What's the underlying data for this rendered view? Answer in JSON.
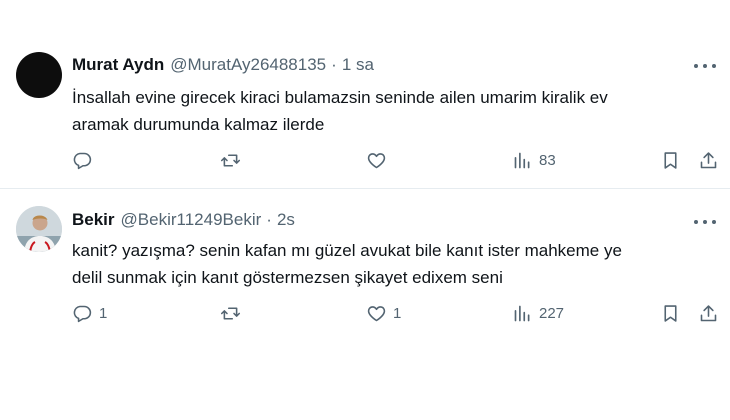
{
  "tweets": [
    {
      "author_name": "Murat Aydn",
      "handle": "@MuratAy26488135",
      "separator": "·",
      "time": "1 sa",
      "text_lines": [
        "İnsallah evine girecek kiraci bulamazsin seninde ailen umarim kiralik ev",
        "aramak durumunda kalmaz ilerde"
      ],
      "replies": "",
      "retweets": "",
      "likes": "",
      "views": "83"
    },
    {
      "author_name": "Bekir",
      "handle": "@Bekir11249Bekir",
      "separator": "·",
      "time": "2s",
      "text_lines": [
        "kanit? yazışma? senin kafan mı güzel avukat bile kanıt ister mahkeme ye",
        "delil sunmak için kanıt göstermezsen şikayet edixem seni"
      ],
      "replies": "1",
      "retweets": "",
      "likes": "1",
      "views": "227"
    }
  ],
  "icons": {
    "reply": "reply-icon",
    "retweet": "retweet-icon",
    "like": "heart-icon",
    "views": "views-chart-icon",
    "bookmark": "bookmark-icon",
    "share": "share-icon",
    "more": "more-icon"
  },
  "colors": {
    "text": "#0f1419",
    "secondary": "#536471",
    "divider": "#e6ecf0"
  }
}
